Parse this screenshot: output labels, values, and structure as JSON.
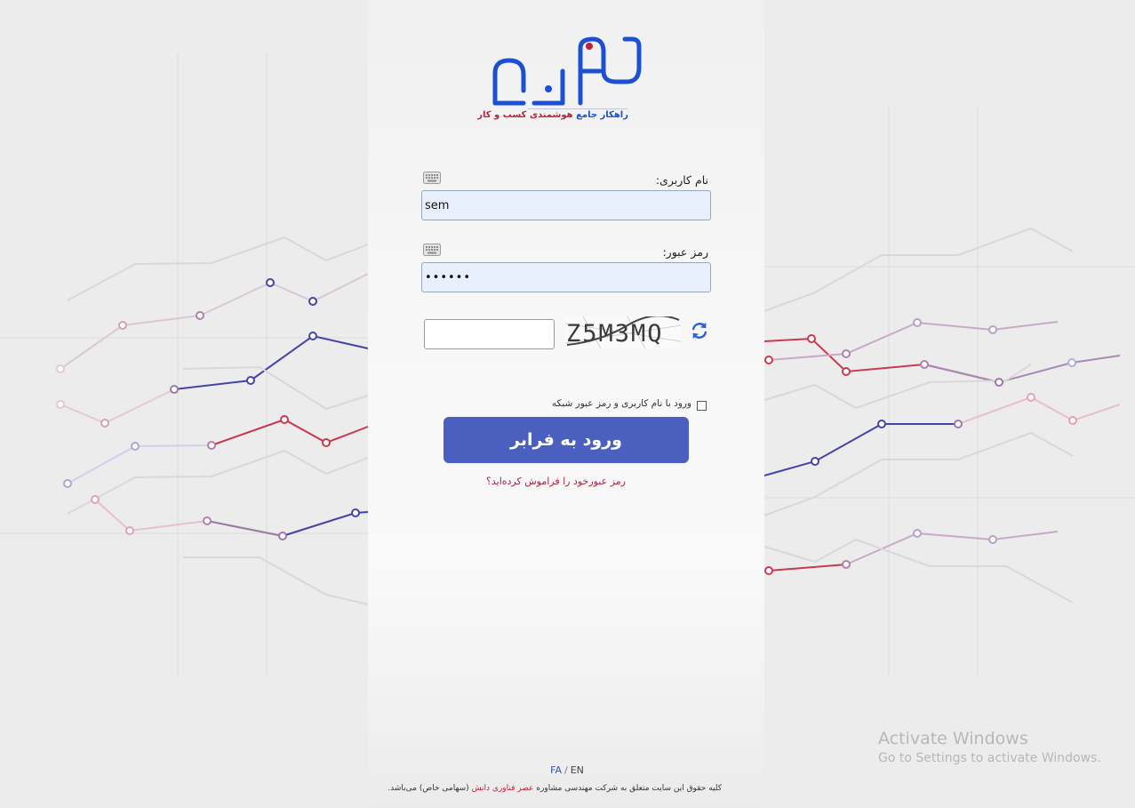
{
  "brand": {
    "tagline_blue": "راهکار جامع",
    "tagline_red": "هوشمندی کسب و کار",
    "accent_blue": "#1d4fd1",
    "accent_red": "#c0203c"
  },
  "login_form": {
    "username_label": "نام کاربری:",
    "username_value": "sem",
    "password_label": "رمز عبور:",
    "password_value": "••••••",
    "keyboard_icon": "keyboard-icon",
    "captcha_text": "Z5M3MQ",
    "captcha_input_value": "",
    "refresh_icon": "refresh-icon",
    "network_login_label": "ورود با نام کاربری و رمز عبور شبکه",
    "network_login_checked": false,
    "submit_label": "ورود به فرابر",
    "submit_color": "#4a5fbe",
    "forgot_password": "رمز عبورخود را فراموش کرده‌اید؟"
  },
  "footer": {
    "lang_fa": "FA",
    "lang_sep": "/",
    "lang_en": "EN",
    "copyright_pre": "کلیه حقوق این سایت متعلق به شرکت مهندسی مشاوره",
    "copyright_company": "عصر فناوری دانش",
    "copyright_post": "(سهامی خاص) می‌باشد."
  },
  "os_watermark": {
    "line1": "Activate Windows",
    "line2": "Go to Settings to activate Windows."
  }
}
